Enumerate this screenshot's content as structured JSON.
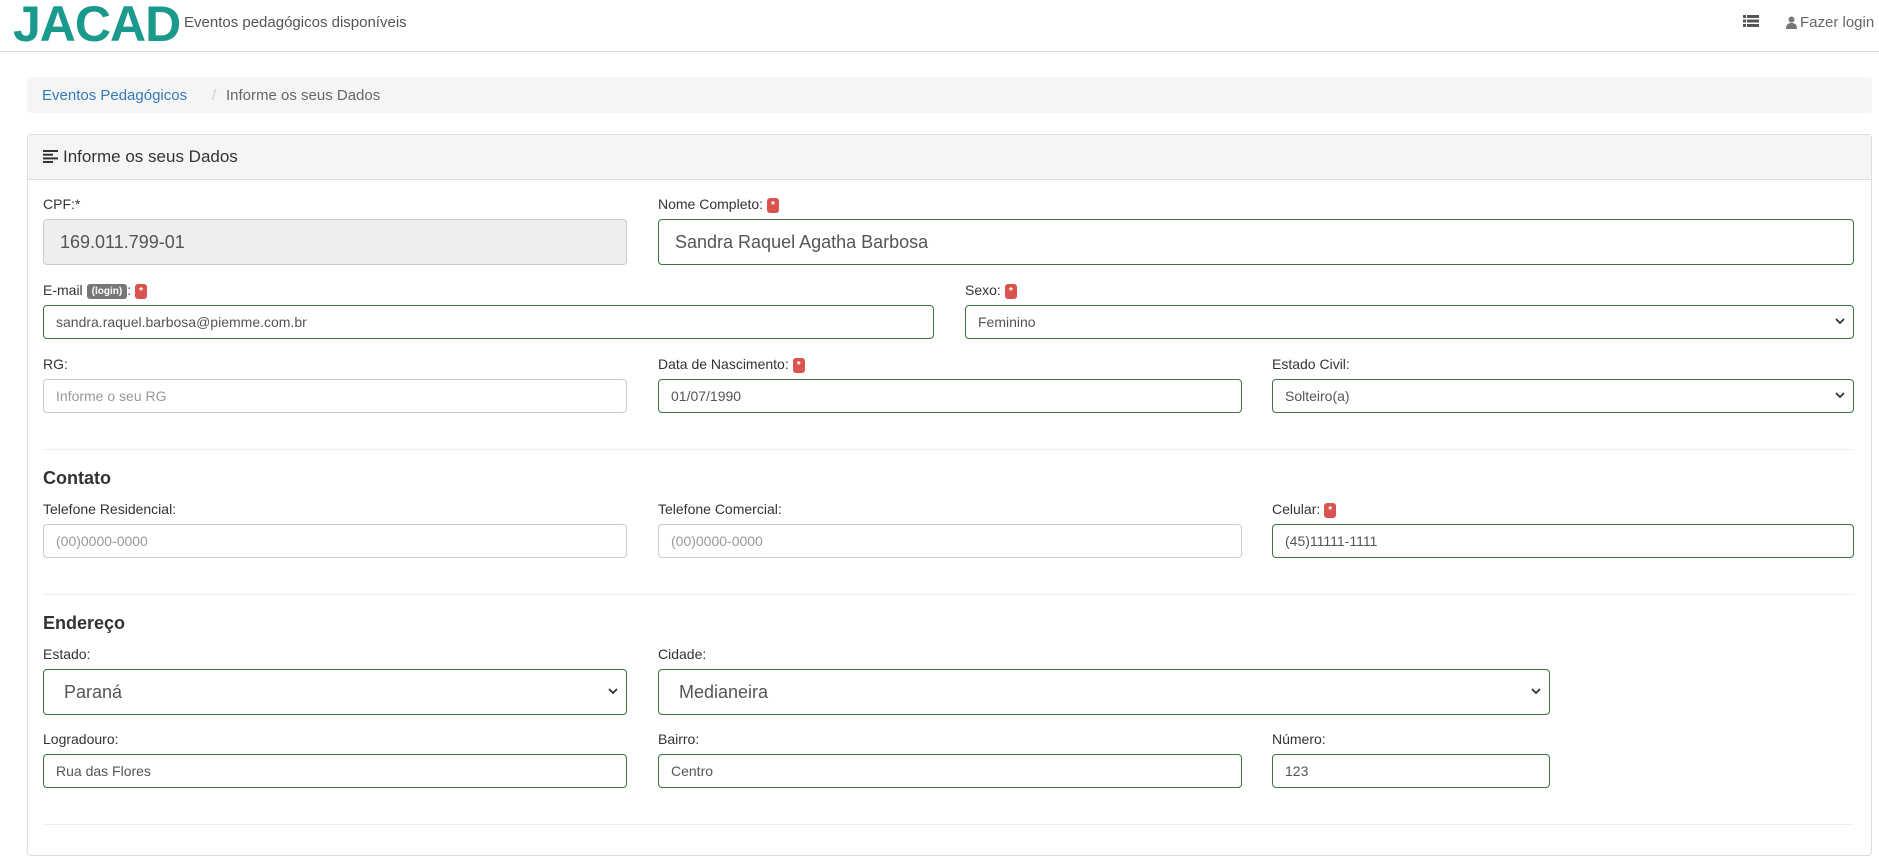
{
  "app": {
    "logo_text": "JACAD",
    "subtitle": "Eventos pedagógicos disponíveis",
    "list_icon": "list-icon",
    "login_label": "Fazer login",
    "user_icon": "user-icon"
  },
  "breadcrumb": {
    "link": "Eventos Pedagógicos",
    "separator": "/",
    "current": "Informe os seus Dados"
  },
  "panel": {
    "title": "Informe os seus Dados",
    "title_icon": "align-left-icon"
  },
  "required_marker": "*",
  "form": {
    "cpf": {
      "label": "CPF:*",
      "value": "169.011.799-01"
    },
    "nome": {
      "label": "Nome Completo:",
      "value": "Sandra Raquel Agatha Barbosa"
    },
    "email": {
      "label": "E-mail",
      "badge": "(login)",
      "colon": ":",
      "value": "sandra.raquel.barbosa@piemme.com.br"
    },
    "sexo": {
      "label": "Sexo:",
      "value": "Feminino"
    },
    "rg": {
      "label": "RG:",
      "value": "",
      "placeholder": "Informe o seu RG"
    },
    "nascimento": {
      "label": "Data de Nascimento:",
      "value": "01/07/1990"
    },
    "estado_civil": {
      "label": "Estado Civil:",
      "value": "Solteiro(a)"
    }
  },
  "contato": {
    "title": "Contato",
    "residencial": {
      "label": "Telefone Residencial:",
      "value": "",
      "placeholder": "(00)0000-0000"
    },
    "comercial": {
      "label": "Telefone Comercial:",
      "value": "",
      "placeholder": "(00)0000-0000"
    },
    "celular": {
      "label": "Celular:",
      "value": "(45)11111-1111"
    }
  },
  "endereco": {
    "title": "Endereço",
    "estado": {
      "label": "Estado:",
      "value": "Paraná"
    },
    "cidade": {
      "label": "Cidade:",
      "value": "Medianeira"
    },
    "logradouro": {
      "label": "Logradouro:",
      "value": "Rua das Flores"
    },
    "bairro": {
      "label": "Bairro:",
      "value": "Centro"
    },
    "numero": {
      "label": "Número:",
      "value": "123"
    }
  },
  "colors": {
    "brand": "#1a9a8c",
    "link": "#337ab7",
    "valid_border": "#3c763d",
    "required_badge": "#d9534f"
  }
}
